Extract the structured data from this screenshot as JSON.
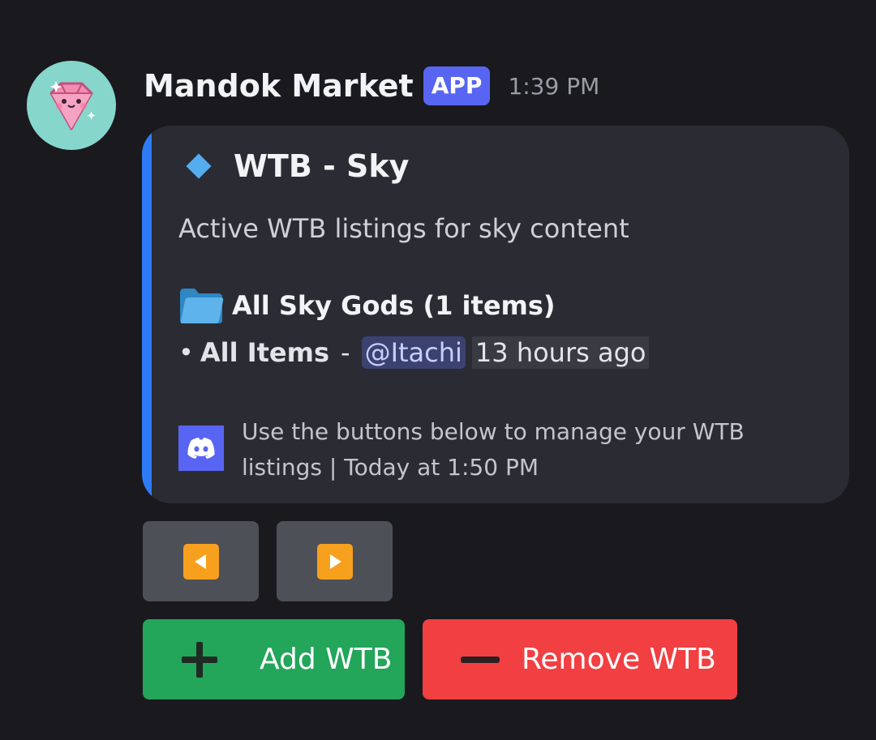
{
  "message": {
    "author": "Mandok Market",
    "badge": "APP",
    "timestamp": "1:39 PM",
    "avatar_icon": "pink-diamond-icon"
  },
  "embed": {
    "accent_color": "#2f7bf5",
    "title": "WTB - Sky",
    "title_icon": "blue-diamond-icon",
    "description": "Active WTB listings for sky content",
    "field": {
      "icon": "folder-icon",
      "name": "All Sky Gods (1 items)",
      "bullet": "•",
      "items_label": "All Items",
      "separator": "-",
      "mention": "@Itachi",
      "relative_time": "13 hours ago"
    },
    "footer": {
      "icon": "discord-icon",
      "text": "Use the buttons below to manage your WTB listings | Today at 1:50 PM"
    }
  },
  "buttons": {
    "prev_icon": "arrow-left-icon",
    "next_icon": "arrow-right-icon",
    "add": {
      "label": "Add WTB",
      "icon": "plus-icon",
      "color": "#23a55a"
    },
    "remove": {
      "label": "Remove WTB",
      "icon": "minus-icon",
      "color": "#f23f42"
    }
  }
}
